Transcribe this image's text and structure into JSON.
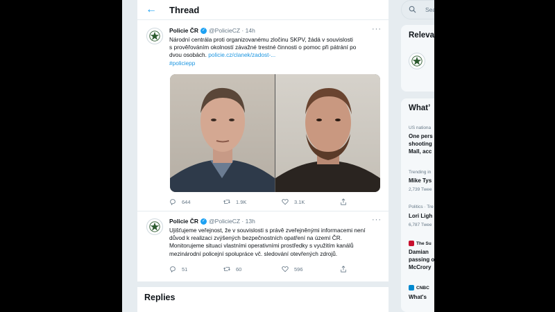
{
  "header": {
    "title": "Thread"
  },
  "tweet1": {
    "name": "Policie ČR",
    "handle": "@PolicieCZ",
    "time": "14h",
    "lines": [
      "Národní centrála proti organizovanému zločinu SKPV, žádá v souvislosti",
      "s prověřováním okolností závažné trestné činnosti o pomoc při pátrání po",
      "dvou osobách."
    ],
    "link": "policie.cz/clanek/zadost-...",
    "hashtag": "#policiepp",
    "replies": "644",
    "retweets": "1.9K",
    "likes": "3.1K"
  },
  "tweet2": {
    "name": "Policie ČR",
    "handle": "@PolicieCZ",
    "time": "13h",
    "lines": [
      "Ujišťujeme veřejnost, že v souvislosti s právě zveřejněnými informacemi není",
      "důvod k realizaci zvýšených bezpečnostních opatření na území ČR.",
      "Monitorujeme situaci vlastními operativními prostředky s využitím kanálů",
      "mezinárodní policejní spolupráce vč. sledování otevřených zdrojů."
    ],
    "replies": "51",
    "retweets": "60",
    "likes": "596"
  },
  "replies_title": "Replies",
  "sidebar": {
    "search_placeholder": "Sea",
    "relevant_title": "Releva",
    "whats_title": "What’",
    "trends": [
      {
        "context": "US nationa",
        "lines": [
          "One pers",
          "shooting",
          "Mall, acc"
        ]
      },
      {
        "context": "Trending in",
        "lines": [
          "Mike Tys"
        ],
        "count": "2,739 Twee"
      },
      {
        "context": "Politics · Tre",
        "lines": [
          "Lori Ligh"
        ],
        "count": "6,787 Twee"
      }
    ],
    "news": [
      {
        "source": "The Su",
        "lines": [
          "Damian",
          "passing o",
          "McCrory"
        ],
        "color": "#c8102e"
      },
      {
        "source": "CNBC",
        "lines": [
          "What's"
        ],
        "color": "#0089cf"
      }
    ]
  },
  "colors": {
    "accent": "#1da1f2",
    "link": "#1b95e0",
    "muted": "#657786",
    "bg": "#e6ecf0"
  }
}
